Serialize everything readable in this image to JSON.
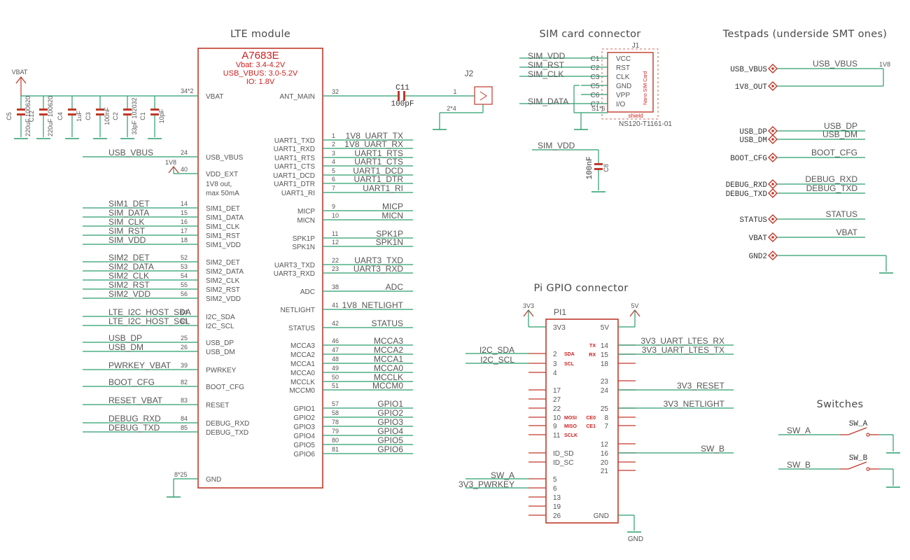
{
  "headings": {
    "lte": "LTE module",
    "sim": "SIM card connector",
    "testpads": "Testpads (underside SMT ones)",
    "gpio": "Pi GPIO connector",
    "switches": "Switches"
  },
  "colors": {
    "symbol": "#c0392b",
    "wire": "#2a9d6e",
    "text": "#555555",
    "ground": "#2a9d6e"
  },
  "module": {
    "name": "A7683E",
    "specs": [
      "Vbat: 3.4-4.2V",
      "USB_VBUS: 3.0-5.2V",
      "IO: 1.8V"
    ],
    "vbat_pins": "34*2",
    "gnd_pins": "8*25",
    "vddext_desc": [
      "1V8 out,",
      "max 50mA"
    ],
    "left_pins": [
      {
        "num": "24",
        "name": "USB_VBUS",
        "net": "USB_VBUS"
      },
      {
        "num": "40",
        "name": "VDD_EXT",
        "net": ""
      },
      {
        "num": "14",
        "name": "SIM1_DET",
        "net": "SIM1_DET"
      },
      {
        "num": "15",
        "name": "SIM1_DATA",
        "net": "SIM_DATA"
      },
      {
        "num": "16",
        "name": "SIM1_CLK",
        "net": "SIM_CLK"
      },
      {
        "num": "17",
        "name": "SIM1_RST",
        "net": "SIM_RST"
      },
      {
        "num": "18",
        "name": "SIM1_VDD",
        "net": "SIM_VDD"
      },
      {
        "num": "52",
        "name": "SIM2_DET",
        "net": "SIM2_DET"
      },
      {
        "num": "53",
        "name": "SIM2_DATA",
        "net": "SIM2_DATA"
      },
      {
        "num": "54",
        "name": "SIM2_CLK",
        "net": "SIM2_CLK"
      },
      {
        "num": "55",
        "name": "SIM2_RST",
        "net": "SIM2_RST"
      },
      {
        "num": "56",
        "name": "SIM2_VDD",
        "net": "SIM2_VDD"
      },
      {
        "num": "64",
        "name": "I2C_SDA",
        "net": "LTE_I2C_HOST_SDA"
      },
      {
        "num": "65",
        "name": "I2C_SCL",
        "net": "LTE_I2C_HOST_SCL"
      },
      {
        "num": "25",
        "name": "USB_DP",
        "net": "USB_DP"
      },
      {
        "num": "26",
        "name": "USB_DM",
        "net": "USB_DM"
      },
      {
        "num": "39",
        "name": "PWRKEY",
        "net": "PWRKEY_VBAT"
      },
      {
        "num": "82",
        "name": "BOOT_CFG",
        "net": "BOOT_CFG"
      },
      {
        "num": "83",
        "name": "RESET",
        "net": "RESET_VBAT"
      },
      {
        "num": "84",
        "name": "DEBUG_RXD",
        "net": "DEBUG_RXD"
      },
      {
        "num": "85",
        "name": "DEBUG_TXD",
        "net": "DEBUG_TXD"
      }
    ],
    "right_pins": [
      {
        "num": "32",
        "name": "ANT_MAIN",
        "net": ""
      },
      {
        "num": "1",
        "name": "UART1_TXD",
        "net": "1V8_UART_TX"
      },
      {
        "num": "2",
        "name": "UART1_RXD",
        "net": "1V8_UART_RX"
      },
      {
        "num": "3",
        "name": "UART1_RTS",
        "net": "UART1_RTS"
      },
      {
        "num": "4",
        "name": "UART1_CTS",
        "net": "UART1_CTS"
      },
      {
        "num": "5",
        "name": "UART1_DCD",
        "net": "UART1_DCD"
      },
      {
        "num": "6",
        "name": "UART1_DTR",
        "net": "UART1_DTR"
      },
      {
        "num": "7",
        "name": "UART1_RI",
        "net": "UART1_RI"
      },
      {
        "num": "9",
        "name": "MICP",
        "net": "MICP"
      },
      {
        "num": "10",
        "name": "MICN",
        "net": "MICN"
      },
      {
        "num": "11",
        "name": "SPK1P",
        "net": "SPK1P"
      },
      {
        "num": "12",
        "name": "SPK1N",
        "net": "SPK1N"
      },
      {
        "num": "22",
        "name": "UART3_TXD",
        "net": "UART3_TXD"
      },
      {
        "num": "23",
        "name": "UART3_RXD",
        "net": "UART3_RXD"
      },
      {
        "num": "38",
        "name": "ADC",
        "net": "ADC"
      },
      {
        "num": "41",
        "name": "NETLIGHT",
        "net": "1V8_NETLIGHT"
      },
      {
        "num": "42",
        "name": "STATUS",
        "net": "STATUS"
      },
      {
        "num": "46",
        "name": "MCCA3",
        "net": "MCCA3"
      },
      {
        "num": "47",
        "name": "MCCA2",
        "net": "MCCA2"
      },
      {
        "num": "48",
        "name": "MCCA1",
        "net": "MCCA1"
      },
      {
        "num": "49",
        "name": "MCCA0",
        "net": "MCCA0"
      },
      {
        "num": "50",
        "name": "MCCLK",
        "net": "MCCLK"
      },
      {
        "num": "51",
        "name": "MCCM0",
        "net": "MCCM0"
      },
      {
        "num": "57",
        "name": "GPIO1",
        "net": "GPIO1"
      },
      {
        "num": "58",
        "name": "GPIO2",
        "net": "GPIO2"
      },
      {
        "num": "78",
        "name": "GPIO3",
        "net": "GPIO3"
      },
      {
        "num": "79",
        "name": "GPIO4",
        "net": "GPIO4"
      },
      {
        "num": "80",
        "name": "GPIO5",
        "net": "GPIO5"
      },
      {
        "num": "81",
        "name": "GPIO6",
        "net": "GPIO6"
      }
    ]
  },
  "power": {
    "vbat": "VBAT",
    "v1v8": "1V8",
    "v3v3": "3V3",
    "v5v": "5V",
    "gnd": "GND"
  },
  "caps": [
    {
      "ref": "C5",
      "val": "220uF 100620"
    },
    {
      "ref": "C12",
      "val": "220uF 100620"
    },
    {
      "ref": "C4",
      "val": "1uF"
    },
    {
      "ref": "C3",
      "val": "100nF"
    },
    {
      "ref": "C2",
      "val": "33pF 102032"
    },
    {
      "ref": "C1",
      "val": "10pF"
    }
  ],
  "antenna": {
    "cap_ref": "C11",
    "cap_val": "100pF",
    "conn": "J2",
    "pin1": "1",
    "pin2": "2*4"
  },
  "sim_card": {
    "ref": "J1",
    "part": "NS120-T1161-01",
    "body_label": "Nano SIM Card",
    "shield": "shield",
    "shield_pin": "S1*6",
    "pins": [
      {
        "pin": "C1",
        "name": "VCC",
        "net": "SIM_VDD"
      },
      {
        "pin": "C2",
        "name": "RST",
        "net": "SIM_RST"
      },
      {
        "pin": "C3",
        "name": "CLK",
        "net": "SIM_CLK"
      },
      {
        "pin": "C5",
        "name": "GND",
        "net": ""
      },
      {
        "pin": "C6",
        "name": "VPP",
        "net": ""
      },
      {
        "pin": "C7",
        "name": "I/O",
        "net": "SIM_DATA"
      }
    ],
    "decoupling": {
      "net": "SIM_VDD",
      "ref": "C8",
      "val": "100nF"
    }
  },
  "testpads": [
    {
      "label": "USB_VBUS",
      "net": "USB_VBUS"
    },
    {
      "label": "1V8_OUT",
      "net": ""
    },
    {
      "label": "USB_DP",
      "net": "USB_DP"
    },
    {
      "label": "USB_DM",
      "net": "USB_DM"
    },
    {
      "label": "BOOT_CFG",
      "net": "BOOT_CFG"
    },
    {
      "label": "DEBUG_RXD",
      "net": "DEBUG_RXD"
    },
    {
      "label": "DEBUG_TXD",
      "net": "DEBUG_TXD"
    },
    {
      "label": "STATUS",
      "net": "STATUS"
    },
    {
      "label": "VBAT",
      "net": "VBAT"
    },
    {
      "label": "GND2",
      "net": ""
    }
  ],
  "gpio": {
    "ref": "PI1",
    "left_pins": [
      {
        "num": "",
        "name": "3V3",
        "func": "",
        "net": ""
      },
      {
        "num": "2",
        "name": "",
        "func": "SDA",
        "net": "I2C_SDA"
      },
      {
        "num": "3",
        "name": "",
        "func": "SCL",
        "net": "I2C_SCL"
      },
      {
        "num": "4",
        "name": "",
        "func": "",
        "net": ""
      },
      {
        "num": "17",
        "name": "",
        "func": "",
        "net": ""
      },
      {
        "num": "27",
        "name": "",
        "func": "",
        "net": ""
      },
      {
        "num": "22",
        "name": "",
        "func": "",
        "net": ""
      },
      {
        "num": "10",
        "name": "",
        "func": "MOSI",
        "net": ""
      },
      {
        "num": "9",
        "name": "",
        "func": "MISO",
        "net": ""
      },
      {
        "num": "11",
        "name": "",
        "func": "SCLK",
        "net": ""
      },
      {
        "num": "",
        "name": "ID_SD",
        "func": "",
        "net": ""
      },
      {
        "num": "",
        "name": "ID_SC",
        "func": "",
        "net": ""
      },
      {
        "num": "5",
        "name": "",
        "func": "",
        "net": "SW_A"
      },
      {
        "num": "6",
        "name": "",
        "func": "",
        "net": "3V3_PWRKEY"
      },
      {
        "num": "13",
        "name": "",
        "func": "",
        "net": ""
      },
      {
        "num": "19",
        "name": "",
        "func": "",
        "net": ""
      },
      {
        "num": "26",
        "name": "",
        "func": "",
        "net": ""
      }
    ],
    "right_pins": [
      {
        "num": "",
        "name": "5V",
        "func": "",
        "net": ""
      },
      {
        "num": "14",
        "name": "",
        "func": "TX",
        "net": "3V3_UART_LTES_RX"
      },
      {
        "num": "15",
        "name": "",
        "func": "RX",
        "net": "3V3_UART_LTES_TX"
      },
      {
        "num": "18",
        "name": "",
        "func": "",
        "net": ""
      },
      {
        "num": "23",
        "name": "",
        "func": "",
        "net": ""
      },
      {
        "num": "24",
        "name": "",
        "func": "",
        "net": "3V3_RESET"
      },
      {
        "num": "25",
        "name": "",
        "func": "",
        "net": "3V3_NETLIGHT"
      },
      {
        "num": "8",
        "name": "",
        "func": "CE0",
        "net": ""
      },
      {
        "num": "7",
        "name": "",
        "func": "CE1",
        "net": ""
      },
      {
        "num": "12",
        "name": "",
        "func": "",
        "net": ""
      },
      {
        "num": "16",
        "name": "",
        "func": "",
        "net": "SW_B"
      },
      {
        "num": "20",
        "name": "",
        "func": "",
        "net": ""
      },
      {
        "num": "21",
        "name": "",
        "func": "",
        "net": ""
      },
      {
        "num": "",
        "name": "GND",
        "func": "",
        "net": ""
      }
    ]
  },
  "switches": [
    {
      "net": "SW_A",
      "ref": "SW_A"
    },
    {
      "net": "SW_B",
      "ref": "SW_B"
    }
  ]
}
